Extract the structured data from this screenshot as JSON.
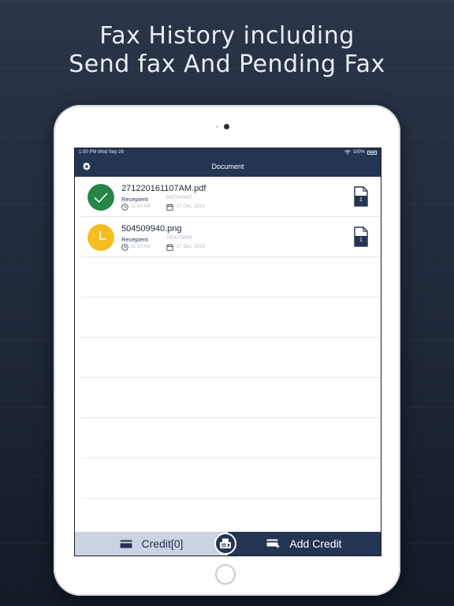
{
  "headline": {
    "line1": "Fax History including",
    "line2": "Send fax And Pending Fax"
  },
  "status_bar": {
    "time_date": "1:00 PM  Wed Sep 26",
    "battery": "100%"
  },
  "nav": {
    "title": "Document",
    "settings_icon": "gear-icon"
  },
  "faxes": [
    {
      "file_name": "271220161107AM.pdf",
      "recipient_label": "Recepient",
      "recipient_value": ": 9097845667",
      "time": "11:08 AM",
      "date": "27 Dec, 2016",
      "status": "sent",
      "status_color": "#258447",
      "pages": "1"
    },
    {
      "file_name": "504509940.png",
      "recipient_label": "Recepient",
      "recipient_value": ": 7654378908",
      "time": "11:10 AM",
      "date": "27 Dec, 2016",
      "status": "pending",
      "status_color": "#f5bd1f",
      "pages": "1"
    }
  ],
  "tabs": {
    "credit_label": "Credit[0]",
    "add_credit_label": "Add Credit"
  },
  "colors": {
    "navy": "#243553",
    "tab_light": "#c9d3e1"
  }
}
